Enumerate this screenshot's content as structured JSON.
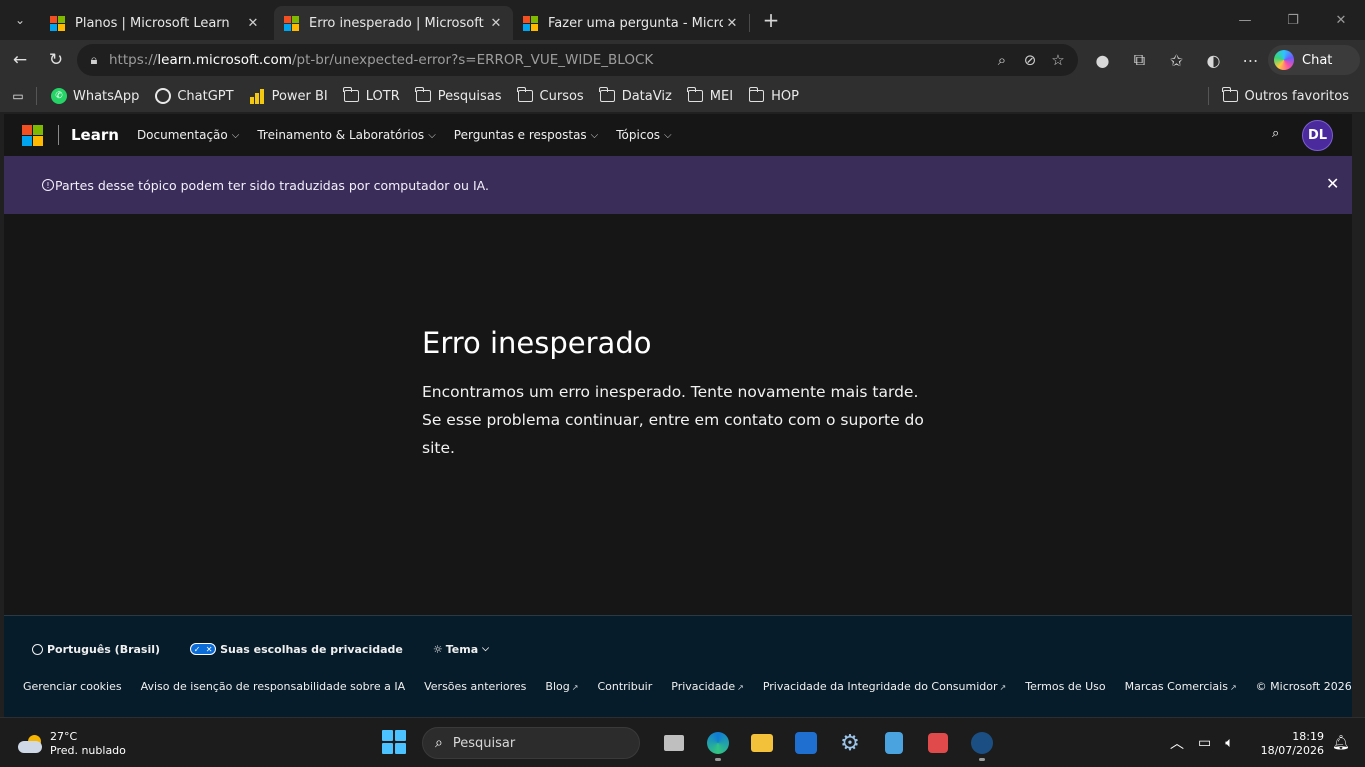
{
  "tabs": [
    {
      "title": "Planos | Microsoft Learn",
      "active": false
    },
    {
      "title": "Erro inesperado | Microsoft Learn",
      "active": true
    },
    {
      "title": "Fazer uma pergunta - Microsoft Q&A",
      "active": false
    }
  ],
  "window_controls": {
    "minimize": "—",
    "restore": "❐",
    "close": "✕"
  },
  "address_bar": {
    "url_prefix": "https://",
    "url_host": "learn.microsoft.com",
    "url_path": "/pt-br/unexpected-error?s=ERROR_VUE_WIDE_BLOCK"
  },
  "chat_label": "Chat",
  "favorites": [
    {
      "label": "WhatsApp",
      "icon": "whatsapp-icon"
    },
    {
      "label": "ChatGPT",
      "icon": "chatgpt-icon"
    },
    {
      "label": "Power BI",
      "icon": "powerbi-icon"
    },
    {
      "label": "LOTR",
      "icon": "folder-icon"
    },
    {
      "label": "Pesquisas",
      "icon": "folder-icon"
    },
    {
      "label": "Cursos",
      "icon": "folder-icon"
    },
    {
      "label": "DataViz",
      "icon": "folder-icon"
    },
    {
      "label": "MEI",
      "icon": "folder-icon"
    },
    {
      "label": "HOP",
      "icon": "folder-icon"
    }
  ],
  "other_favorites": "Outros favoritos",
  "learn_header": {
    "brand": "Learn",
    "nav": [
      "Documentação",
      "Treinamento & Laboratórios",
      "Perguntas e respostas",
      "Tópicos"
    ],
    "avatar_initials": "DL"
  },
  "banner": {
    "text": "Partes desse tópico podem ter sido traduzidas por computador ou IA."
  },
  "main": {
    "title": "Erro inesperado",
    "body": "Encontramos um erro inesperado. Tente novamente mais tarde. Se esse problema continuar, entre em contato com o suporte do site."
  },
  "footer": {
    "language": "Português (Brasil)",
    "privacy_choices": "Suas escolhas de privacidade",
    "theme": "Tema",
    "links": [
      {
        "label": "Gerenciar cookies",
        "external": false
      },
      {
        "label": "Aviso de isenção de responsabilidade sobre a IA",
        "external": false
      },
      {
        "label": "Versões anteriores",
        "external": false
      },
      {
        "label": "Blog",
        "external": true
      },
      {
        "label": "Contribuir",
        "external": false
      },
      {
        "label": "Privacidade",
        "external": true
      },
      {
        "label": "Privacidade da Integridade do Consumidor",
        "external": true
      },
      {
        "label": "Termos de Uso",
        "external": false
      },
      {
        "label": "Marcas Comerciais",
        "external": true
      }
    ],
    "copyright": "© Microsoft 2026"
  },
  "taskbar": {
    "weather_temp": "27°C",
    "weather_desc": "Pred. nublado",
    "search_placeholder": "Pesquisar",
    "time": "18:19",
    "date": "18/07/2026"
  },
  "colors": {
    "banner_bg": "#3b2d5a",
    "footer_bg": "#071c2a",
    "avatar_bg": "#4b2a9e",
    "accent": "#4cc2ff"
  }
}
